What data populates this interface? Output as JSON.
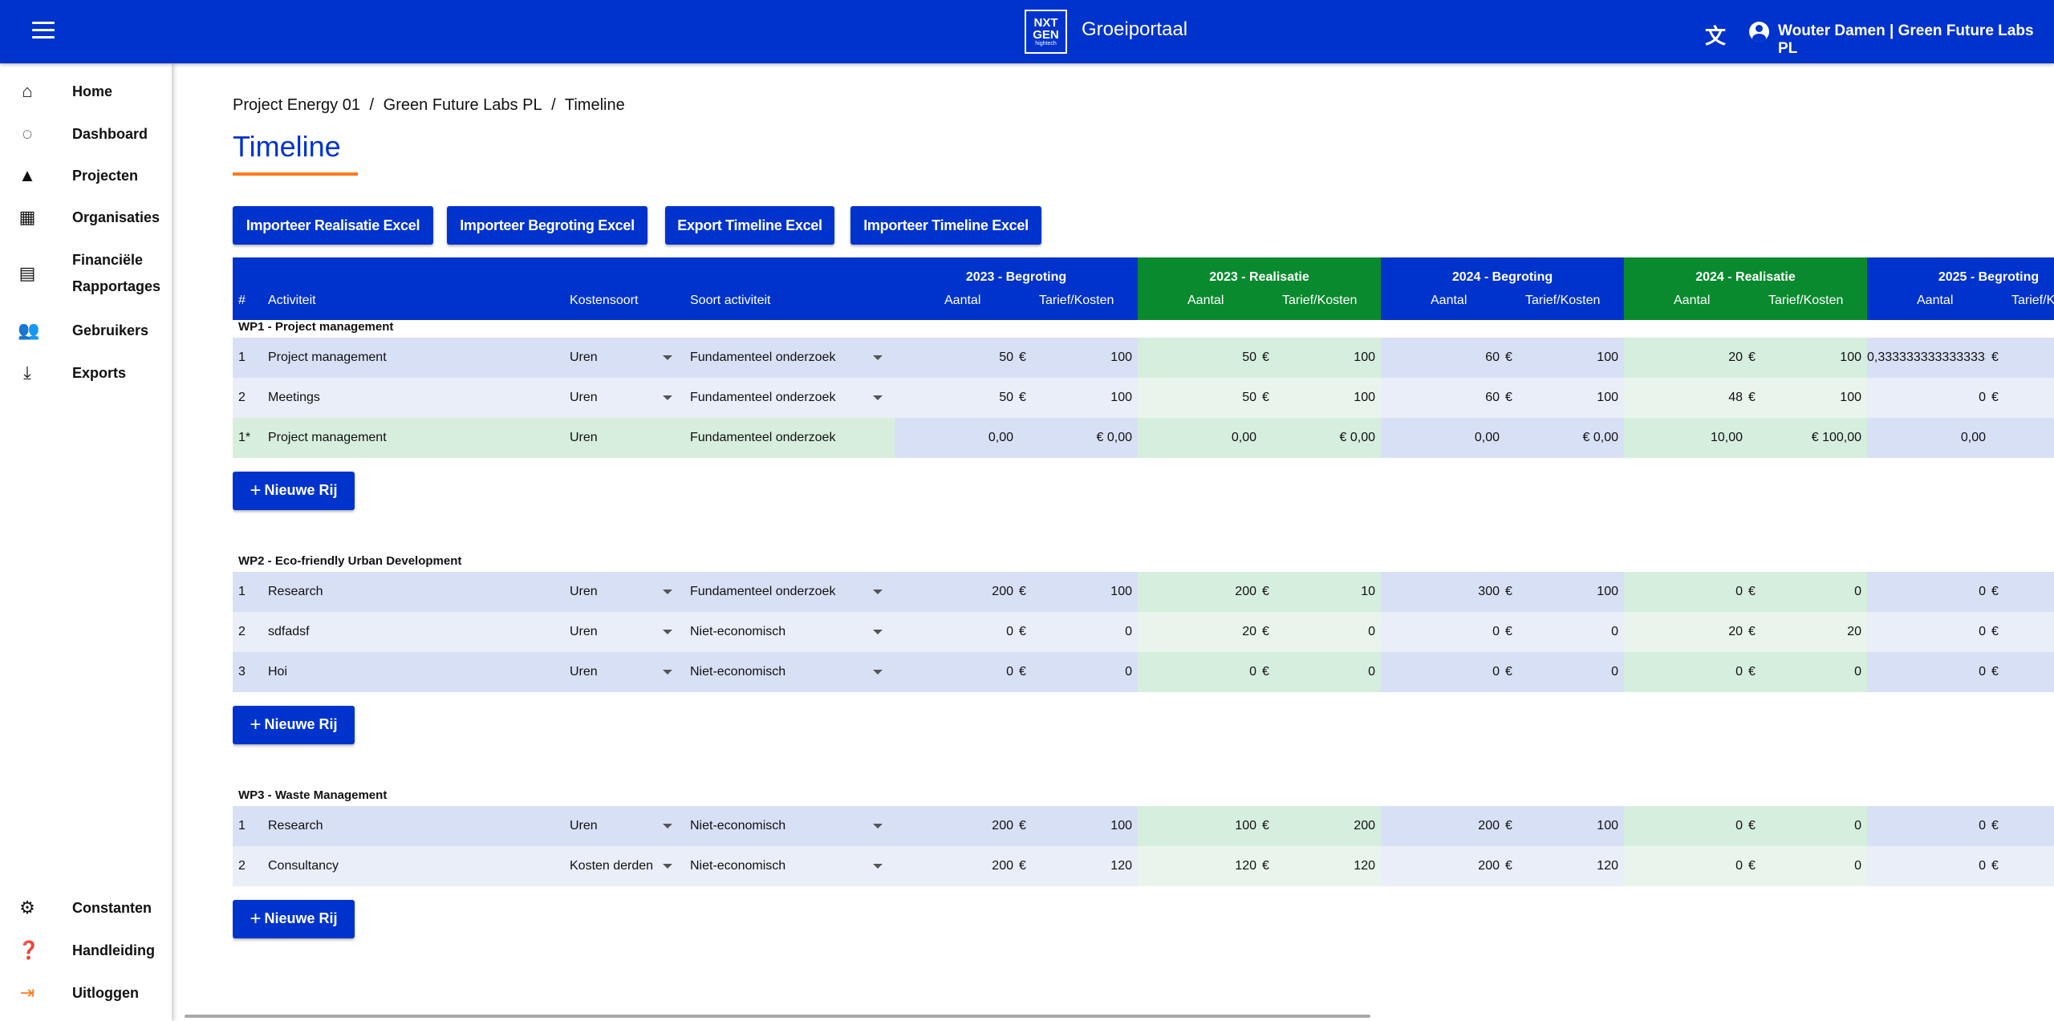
{
  "app": {
    "menu_icon": "hamburger-menu-icon",
    "logo_line1": "NXT",
    "logo_line2": "GEN",
    "logo_line3": "hightech",
    "title": "Groeiportaal",
    "translate_icon": "translate-icon",
    "user_icon": "account-circle-icon",
    "user_name": "Wouter Damen | Green Future Labs PL"
  },
  "sidebar": {
    "items": [
      {
        "label": "Home",
        "icon": "home-icon"
      },
      {
        "label": "Dashboard",
        "icon": "donut-icon"
      },
      {
        "label": "Projecten",
        "icon": "shapes-icon"
      },
      {
        "label": "Organisaties",
        "icon": "building-icon"
      },
      {
        "label": "Financiële",
        "label2": "Rapportages",
        "icon": "clipboard-icon"
      },
      {
        "label": "Gebruikers",
        "icon": "people-icon"
      },
      {
        "label": "Exports",
        "icon": "download-icon"
      }
    ],
    "bottom": [
      {
        "label": "Constanten",
        "icon": "gear-icon"
      },
      {
        "label": "Handleiding",
        "icon": "help-book-icon"
      },
      {
        "label": "Uitloggen",
        "icon": "logout-icon"
      }
    ]
  },
  "breadcrumb": [
    "Project Energy 01",
    "/",
    "Green Future Labs PL",
    "/",
    "Timeline"
  ],
  "page_title": "Timeline",
  "buttons": {
    "import_realisatie": "Importeer Realisatie Excel",
    "import_begroting": "Importeer Begroting Excel",
    "export_timeline": "Export Timeline Excel",
    "import_timeline": "Importeer Timeline Excel"
  },
  "table": {
    "columns": {
      "num": "#",
      "activity": "Activiteit",
      "cost_type": "Kostensoort",
      "activity_type": "Soort activiteit",
      "amount": "Aantal",
      "rate": "Tarief/Kosten"
    },
    "groups": [
      "2023 - Begroting",
      "2023 - Realisatie",
      "2024 - Begroting",
      "2024 - Realisatie",
      "2025 - Begroting"
    ],
    "currency": "€",
    "new_row_label": "Nieuwe Rij",
    "workpackages": [
      {
        "title": "WP1 - Project management",
        "rows": [
          {
            "num": "1",
            "activity": "Project management",
            "cost_type": "Uren",
            "activity_type": "Fundamenteel onderzoek",
            "v": [
              [
                "50",
                "100"
              ],
              [
                "50",
                "100"
              ],
              [
                "60",
                "100"
              ],
              [
                "20",
                "100"
              ],
              [
                "0,3333333333333333",
                ""
              ]
            ]
          },
          {
            "num": "2",
            "activity": "Meetings",
            "cost_type": "Uren",
            "activity_type": "Fundamenteel onderzoek",
            "v": [
              [
                "50",
                "100"
              ],
              [
                "50",
                "100"
              ],
              [
                "60",
                "100"
              ],
              [
                "48",
                "100"
              ],
              [
                "0",
                ""
              ]
            ]
          }
        ],
        "summary": {
          "num": "1*",
          "activity": "Project management",
          "cost_type": "Uren",
          "activity_type": "Fundamenteel onderzoek",
          "v": [
            [
              "0,00",
              "€ 0,00"
            ],
            [
              "0,00",
              "€ 0,00"
            ],
            [
              "0,00",
              "€ 0,00"
            ],
            [
              "10,00",
              "€ 100,00"
            ],
            [
              "0,00",
              ""
            ]
          ]
        }
      },
      {
        "title": "WP2 - Eco-friendly Urban Development",
        "rows": [
          {
            "num": "1",
            "activity": "Research",
            "cost_type": "Uren",
            "activity_type": "Fundamenteel onderzoek",
            "v": [
              [
                "200",
                "100"
              ],
              [
                "200",
                "10"
              ],
              [
                "300",
                "100"
              ],
              [
                "0",
                "0"
              ],
              [
                "0",
                ""
              ]
            ]
          },
          {
            "num": "2",
            "activity": "sdfadsf",
            "cost_type": "Uren",
            "activity_type": "Niet-economisch",
            "v": [
              [
                "0",
                "0"
              ],
              [
                "20",
                "0"
              ],
              [
                "0",
                "0"
              ],
              [
                "20",
                "20"
              ],
              [
                "0",
                ""
              ]
            ]
          },
          {
            "num": "3",
            "activity": "Hoi",
            "cost_type": "Uren",
            "activity_type": "Niet-economisch",
            "v": [
              [
                "0",
                "0"
              ],
              [
                "0",
                "0"
              ],
              [
                "0",
                "0"
              ],
              [
                "0",
                "0"
              ],
              [
                "0",
                ""
              ]
            ]
          }
        ]
      },
      {
        "title": "WP3 - Waste Management",
        "rows": [
          {
            "num": "1",
            "activity": "Research",
            "cost_type": "Uren",
            "activity_type": "Niet-economisch",
            "v": [
              [
                "200",
                "100"
              ],
              [
                "100",
                "200"
              ],
              [
                "200",
                "100"
              ],
              [
                "0",
                "0"
              ],
              [
                "0",
                ""
              ]
            ]
          },
          {
            "num": "2",
            "activity": "Consultancy",
            "cost_type": "Kosten derden",
            "activity_type": "Niet-economisch",
            "v": [
              [
                "200",
                "120"
              ],
              [
                "120",
                "120"
              ],
              [
                "200",
                "120"
              ],
              [
                "0",
                "0"
              ],
              [
                "0",
                ""
              ]
            ]
          }
        ]
      }
    ]
  }
}
